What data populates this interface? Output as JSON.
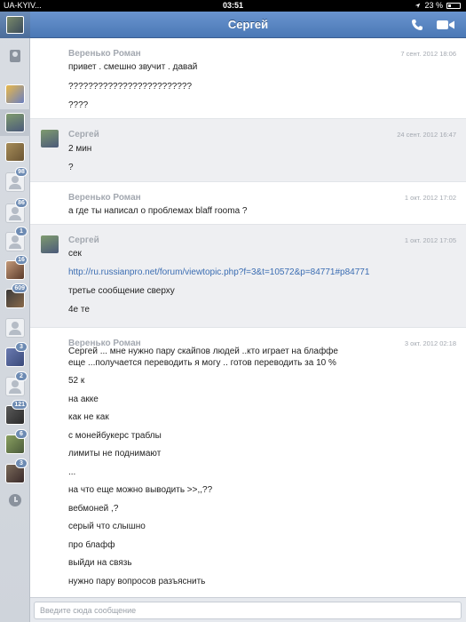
{
  "status_bar": {
    "carrier": "UA-KYIV...",
    "time": "03:51",
    "battery": "23 %",
    "battery_level": 0.23
  },
  "header": {
    "title": "Сергей"
  },
  "sidebar": {
    "badges": [
      "98",
      "86",
      "1",
      "16",
      "609",
      "3",
      "2",
      "121",
      "6",
      "3"
    ]
  },
  "input": {
    "placeholder": "Введите сюда сообщение"
  },
  "messages": [
    {
      "author": "Веренько Роман",
      "date": "7 сент. 2012 18:06",
      "lines": [
        "привет . смешно звучит . давай",
        "?????????????????????????",
        "????"
      ]
    },
    {
      "author": "Сергей",
      "date": "24 сент. 2012 16:47",
      "lines": [
        "2 мин",
        "?"
      ]
    },
    {
      "author": "Веренько Роман",
      "date": "1 окт. 2012 17:02",
      "lines": [
        "а где ты написал о проблемах blaff rooma ?"
      ]
    },
    {
      "author": "Сергей",
      "date": "1 окт. 2012 17:05",
      "lines": [
        "сек",
        "http://ru.russianpro.net/forum/viewtopic.php?f=3&t=10572&p=84771#p84771",
        "третье сообщение сверху",
        "4е те"
      ]
    },
    {
      "author": "Веренько Роман",
      "date": "3 окт. 2012 02:18",
      "lines": [
        "Сергей ... мне нужно пару скайпов людей ..кто играет на блаффе",
        "еще ...получается переводить я могу .. готов переводить за 10 %",
        "52 к",
        "на акке",
        "как не как",
        "с монейбукерс траблы",
        "лимиты не поднимают",
        "...",
        "на что еще можно выводить >>,,??",
        "вебмоней ,?",
        "серый что слышно",
        "про блафф",
        "выйди на связь",
        "нужно пару вопросов разъяснить"
      ]
    }
  ]
}
